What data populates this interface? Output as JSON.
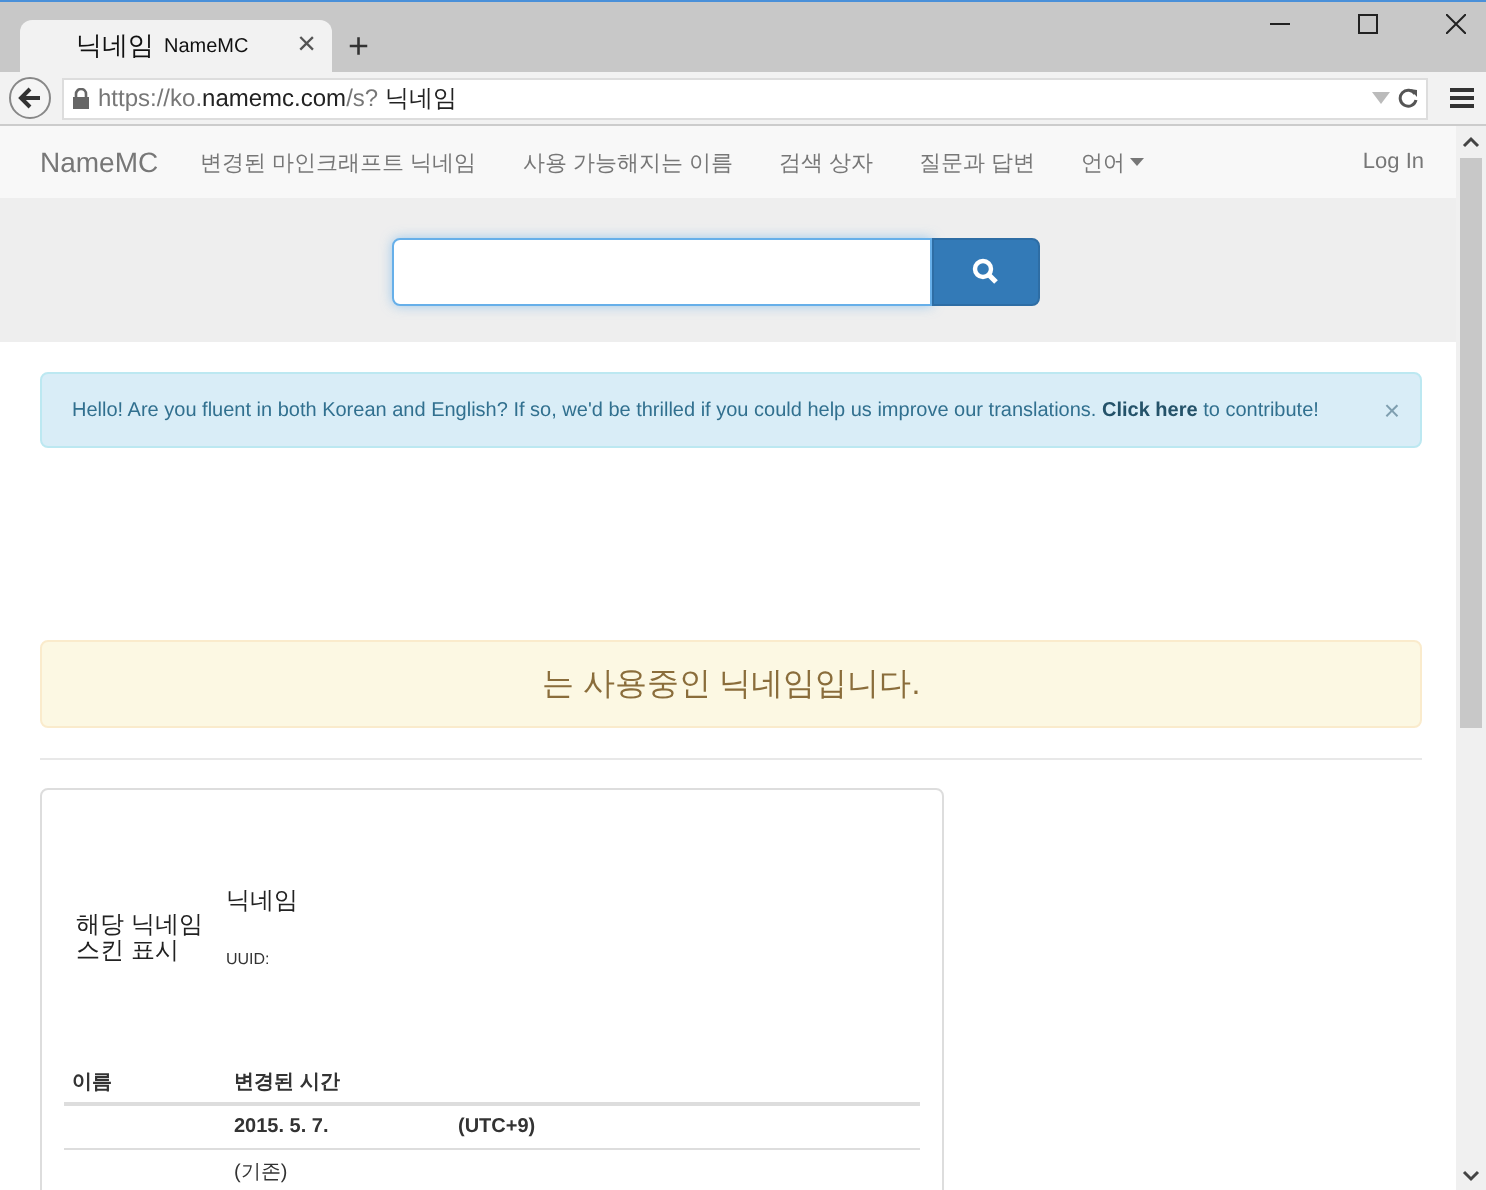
{
  "browser": {
    "tab": {
      "title": "닉네임",
      "subtitle": "NameMC",
      "close": "×"
    },
    "new_tab": "+",
    "address": {
      "parts": [
        {
          "text": "https://ko.",
          "dim": true
        },
        {
          "text": "namemc.com",
          "dim": false
        },
        {
          "text": "/s?",
          "dim": true
        },
        {
          "text": " 닉네임",
          "dim": false
        }
      ]
    }
  },
  "navbar": {
    "brand": "NameMC",
    "items": [
      {
        "label": "변경된 마인크래프트 닉네임",
        "dropdown": false
      },
      {
        "label": "사용 가능해지는 이름",
        "dropdown": false
      },
      {
        "label": "검색 상자",
        "dropdown": false
      },
      {
        "label": "질문과 답변",
        "dropdown": false
      },
      {
        "label": "언어",
        "dropdown": true
      }
    ],
    "login": "Log In"
  },
  "alert": {
    "text_before": "Hello! Are you fluent in both Korean and English? If so, we'd be thrilled if you could help us improve our translations. ",
    "link": "Click here",
    "text_after": " to contribute!",
    "close": "×"
  },
  "status": "는 사용중인 닉네임입니다.",
  "profile": {
    "skin_label": "해당 닉네임\n스킨 표시",
    "name": "닉네임",
    "uuid_label": "UUID:",
    "columns": [
      "이름",
      "변경된 시간"
    ],
    "rows": [
      {
        "date": "2015. 5. 7.",
        "zone": "(UTC+9)"
      },
      {
        "date": "(기존)"
      }
    ]
  }
}
